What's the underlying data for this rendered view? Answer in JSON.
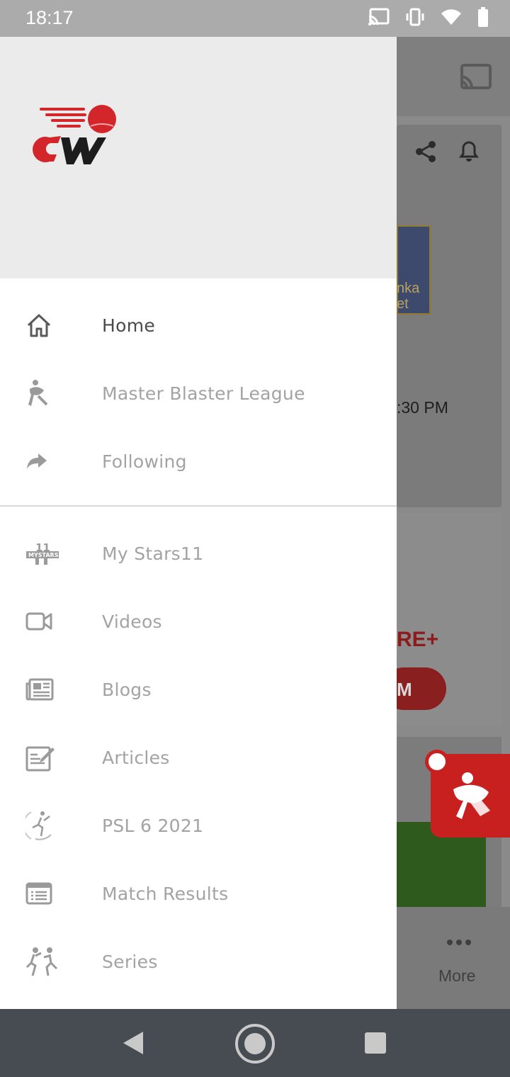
{
  "status_bar": {
    "time": "18:17",
    "icons": [
      "cast-icon",
      "vibrate-icon",
      "wifi-icon",
      "battery-icon"
    ]
  },
  "drawer": {
    "logo_text": "CW",
    "primary_items": [
      {
        "label": "Home",
        "icon": "home-icon",
        "active": true
      },
      {
        "label": "Master Blaster League",
        "icon": "batsman-icon",
        "active": false
      },
      {
        "label": "Following",
        "icon": "share-arrow-icon",
        "active": false
      }
    ],
    "secondary_items": [
      {
        "label": "My Stars11",
        "icon": "mystars-icon"
      },
      {
        "label": "Videos",
        "icon": "video-camera-icon"
      },
      {
        "label": "Blogs",
        "icon": "newspaper-icon"
      },
      {
        "label": "Articles",
        "icon": "article-edit-icon"
      },
      {
        "label": "PSL 6 2021",
        "icon": "psl-icon"
      },
      {
        "label": "Match Results",
        "icon": "list-icon"
      },
      {
        "label": "Series",
        "icon": "players-icon"
      }
    ]
  },
  "background": {
    "crest_text": "nka\net",
    "match_time": ":30 PM",
    "banner_text": "RE+",
    "button_text": "M",
    "bottom_nav_label": "More"
  },
  "colors": {
    "brand_red": "#c8201f",
    "drawer_header_bg": "#ebebeb",
    "active_text": "#4a4a4a",
    "inactive_text": "#a3a3a3"
  }
}
